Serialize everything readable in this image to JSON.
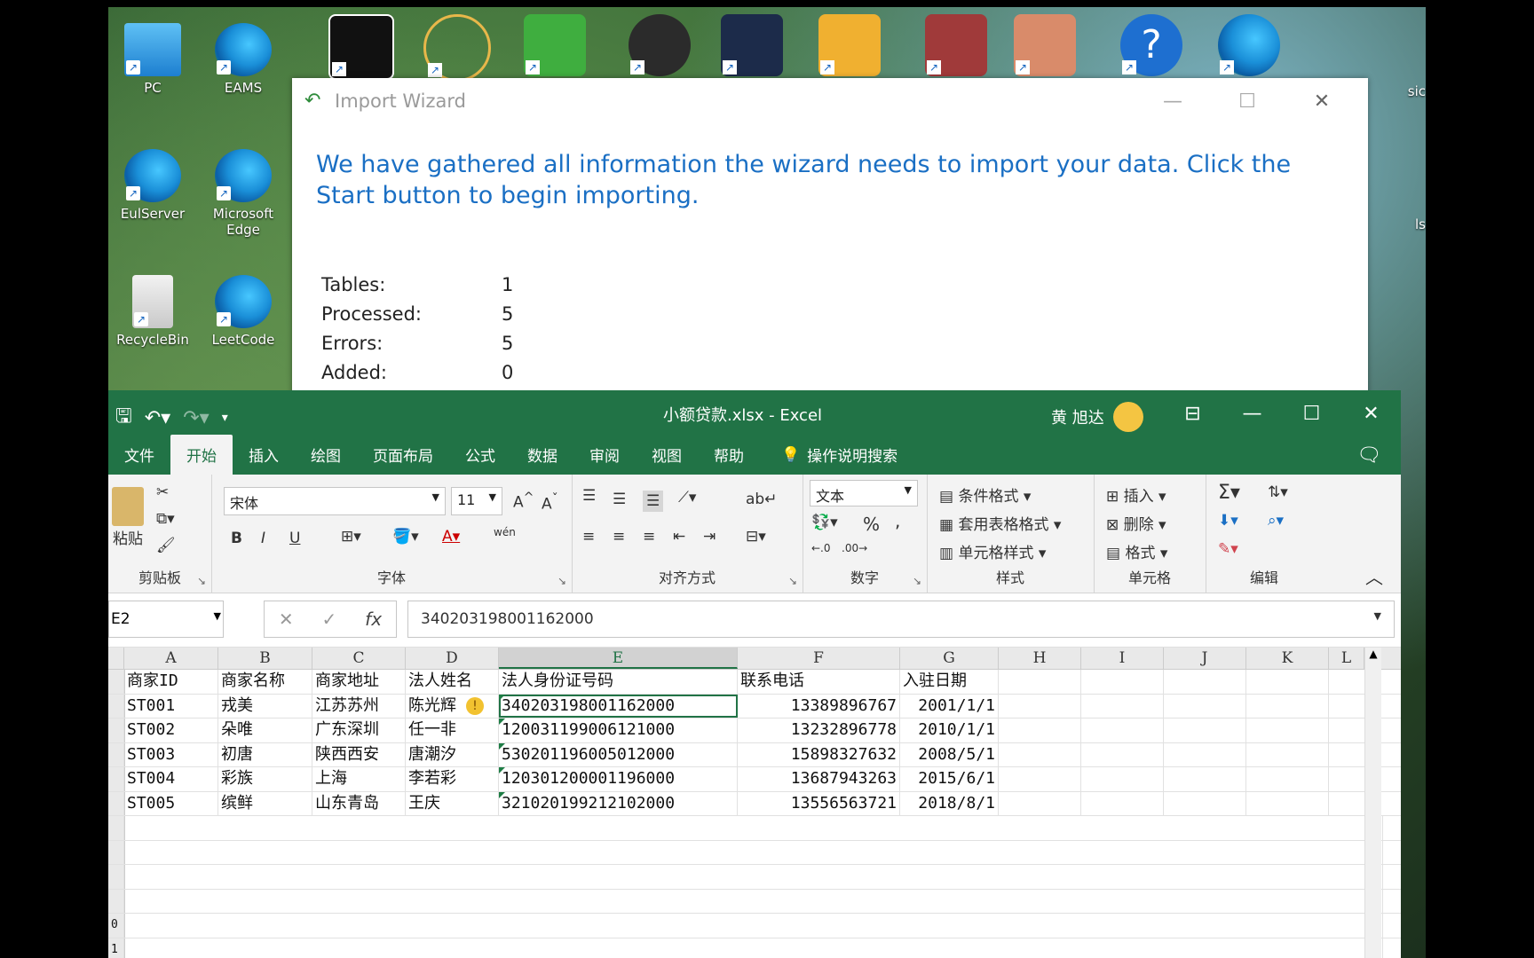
{
  "desktop": {
    "icons": [
      {
        "label": "PC",
        "name": "pc-icon"
      },
      {
        "label": "EAMS",
        "name": "edge-eams-icon"
      },
      {
        "label": "EulServer",
        "name": "edge-eulserver-icon"
      },
      {
        "label": "Microsoft Edge",
        "name": "edge-icon"
      },
      {
        "label": "RecycleBin",
        "name": "recycle-bin-icon"
      },
      {
        "label": "LeetCode",
        "name": "edge-leetcode-icon"
      }
    ],
    "right_labels": [
      "sic",
      "ls"
    ]
  },
  "wizard": {
    "title": "Import Wizard",
    "message": "We have gathered all information the wizard needs to import your data. Click the Start button to begin importing.",
    "stats": [
      {
        "label": "Tables:",
        "value": "1"
      },
      {
        "label": "Processed:",
        "value": "5"
      },
      {
        "label": "Errors:",
        "value": "5"
      },
      {
        "label": "Added:",
        "value": "0"
      }
    ]
  },
  "excel": {
    "filename": "小额贷款.xlsx  -  Excel",
    "user": "黄 旭达",
    "tabs": [
      "文件",
      "开始",
      "插入",
      "绘图",
      "页面布局",
      "公式",
      "数据",
      "审阅",
      "视图",
      "帮助"
    ],
    "active_tab": "开始",
    "tell_me": "操作说明搜索",
    "ribbon": {
      "clipboard": {
        "paste": "粘贴",
        "label": "剪贴板"
      },
      "font": {
        "name": "宋体",
        "size": "11",
        "label": "字体",
        "bold": "B",
        "italic": "I",
        "underline": "U",
        "phonetic": "wén"
      },
      "align": {
        "label": "对齐方式"
      },
      "number": {
        "format": "文本",
        "label": "数字",
        "percent": "%",
        "comma": ","
      },
      "styles": {
        "cond": "条件格式",
        "table": "套用表格格式",
        "cell": "单元格样式",
        "label": "样式"
      },
      "cells": {
        "insert": "插入",
        "delete": "删除",
        "format": "格式",
        "label": "单元格"
      },
      "edit": {
        "label": "编辑"
      }
    },
    "namebox": "E2",
    "formula": "340203198001162000",
    "columns": [
      "A",
      "B",
      "C",
      "D",
      "E",
      "F",
      "G",
      "H",
      "I",
      "J",
      "K",
      "L"
    ],
    "header_row": [
      "商家ID",
      "商家名称",
      "商家地址",
      "法人姓名",
      "法人身份证号码",
      "联系电话",
      "入驻日期"
    ],
    "rows": [
      [
        "ST001",
        "戎美",
        "江苏苏州",
        "陈光辉",
        "340203198001162000",
        "13389896767",
        "2001/1/1"
      ],
      [
        "ST002",
        "朵唯",
        "广东深圳",
        "任一非",
        "120031199006121000",
        "13232896778",
        "2010/1/1"
      ],
      [
        "ST003",
        "初唐",
        "陕西西安",
        "唐潮汐",
        "530201196005012000",
        "15898327632",
        "2008/5/1"
      ],
      [
        "ST004",
        "彩族",
        "上海",
        "李若彩",
        "120301200001196000",
        "13687943263",
        "2015/6/1"
      ],
      [
        "ST005",
        "缤鲜",
        "山东青岛",
        "王庆",
        "321020199212102000",
        "13556563721",
        "2018/8/1"
      ]
    ],
    "row_numbers": [
      "0",
      "1"
    ]
  }
}
